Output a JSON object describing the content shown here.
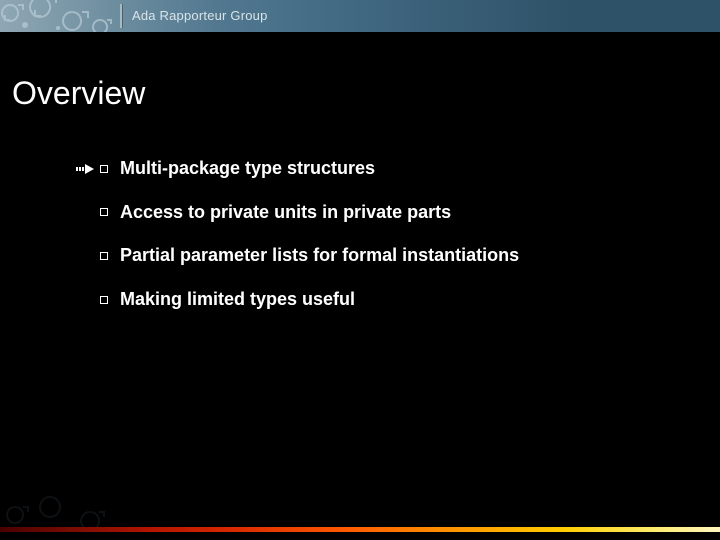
{
  "header": {
    "label": "Ada Rapporteur Group"
  },
  "slide": {
    "title": "Overview",
    "bullets": [
      "Multi-package type structures",
      "Access to private units in private parts",
      "Partial parameter lists for formal instantiations",
      "Making limited types useful"
    ]
  }
}
